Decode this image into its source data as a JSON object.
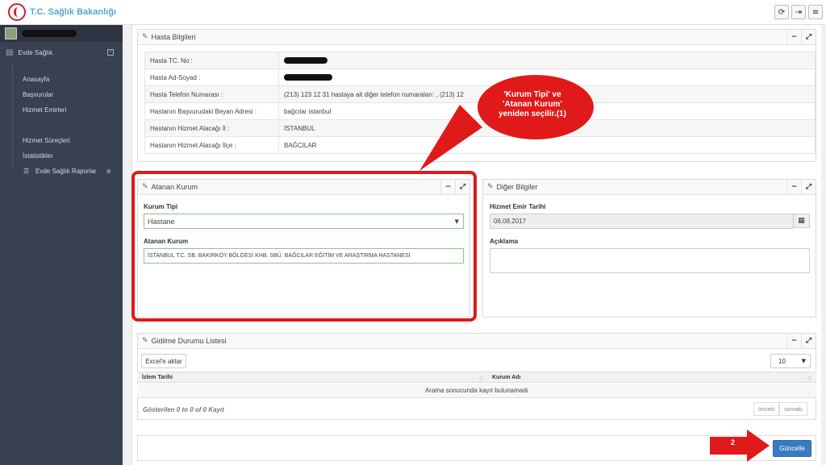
{
  "header": {
    "logo_text": "T.C. Sağlık Bakanlığı",
    "icons": [
      "refresh-icon",
      "logout-icon",
      "menu-icon"
    ]
  },
  "sidebar": {
    "section_title": "Evde Sağlık",
    "items": [
      {
        "label": "Anasayfa"
      },
      {
        "label": "Başvurular"
      },
      {
        "label": "Hizmet Emirleri"
      },
      {
        "label": "Hizmet Süreçleri"
      },
      {
        "label": "İstatistikler"
      },
      {
        "label": "Evde Sağlık Raporlar"
      }
    ]
  },
  "patient_panel": {
    "title": "Hasta Bilgileri",
    "rows": [
      {
        "key": "Hasta TC. No :",
        "value": ""
      },
      {
        "key": "Hasta Ad-Soyad :",
        "value": ""
      },
      {
        "key": "Hasta Telefon Numarası :",
        "value": "(213) 123 12 31 hastaya ait diğer telefon numaraları: , (213) 12"
      },
      {
        "key": "Hastanın Başvurudaki Beyan Adresi :",
        "value": "bağcılar istanbul"
      },
      {
        "key": "Hastanın Hizmet Alacağı İl :",
        "value": "İSTANBUL"
      },
      {
        "key": "Hastanın Hizmet Alacağı İlçe :",
        "value": "BAĞCILAR"
      }
    ]
  },
  "assigned_panel": {
    "title": "Atanan Kurum",
    "type_label": "Kurum Tipi",
    "type_value": "Hastane",
    "inst_label": "Atanan Kurum",
    "inst_value": "İSTANBUL T.C. SB. BAKIRKÖY BÖLGESİ KHB. SBÜ. BAĞCILAR EĞİTİM VE ARAŞTIRMA HASTANESİ"
  },
  "other_panel": {
    "title": "Diğer Bilgiler",
    "date_label": "Hizmet Emir Tarihi",
    "date_value": "06.08.2017",
    "note_label": "Açıklama"
  },
  "callout": {
    "line1": "'Kurum Tipi' ve",
    "line2": "'Atanan Kurum'",
    "line3": "yeniden seçilir.(1)"
  },
  "visits_panel": {
    "title": "Gidilme Durumu Listesi",
    "export_label": "Excel'e aktar",
    "page_size": "10",
    "col1": "İzlem Tarihi",
    "col2": "Kurum Adı",
    "empty_text": "Arama sonucunda kayıt bulunamadı",
    "footer_info": "Gösterilen 0 to 0 of 0 Kayıt",
    "prev_label": "önceki",
    "next_label": "sonraki"
  },
  "actions": {
    "step_label": "2",
    "update_label": "Güncelle"
  },
  "colors": {
    "highlight": "#e01a1a",
    "primary_button": "#3a7bbf",
    "sidebar": "#394050"
  }
}
